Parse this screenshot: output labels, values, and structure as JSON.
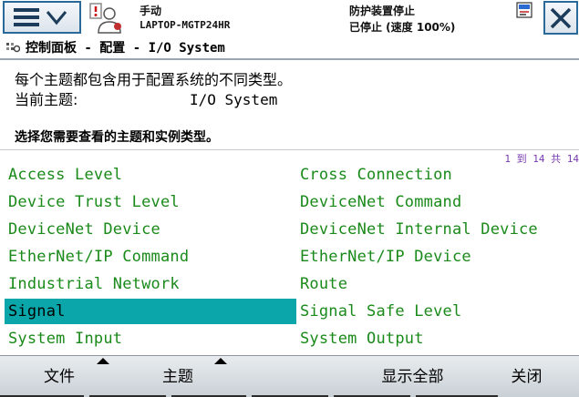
{
  "topbar": {
    "mode": "手动",
    "controller": "LAPTOP-MGTP24HR",
    "safety_state": "防护装置停止",
    "status": "已停止 (速度 100%)"
  },
  "breadcrumb": {
    "text": "控制面板 - 配置 - I/O System"
  },
  "info": {
    "description": "每个主题都包含用于配置系统的不同类型。",
    "current_label": "当前主题:",
    "current_value": "I/O System",
    "prompt": "选择您需要查看的主题和实例类型。"
  },
  "list": {
    "count": "1 到 14 共 14",
    "items": [
      "Access Level",
      "Cross Connection",
      "Device Trust Level",
      "DeviceNet Command",
      "DeviceNet Device",
      "DeviceNet Internal Device",
      "EtherNet/IP Command",
      "EtherNet/IP Device",
      "Industrial Network",
      "Route",
      "Signal",
      "Signal Safe Level",
      "System Input",
      "System Output"
    ],
    "selected": "Signal"
  },
  "toolbar": {
    "file": "文件",
    "topic": "主题",
    "show_all": "显示全部",
    "close": "关闭"
  },
  "colors": {
    "selection": "#0aa6aa",
    "item_text": "#1a8a1a",
    "frame": "#2a6a9a"
  }
}
